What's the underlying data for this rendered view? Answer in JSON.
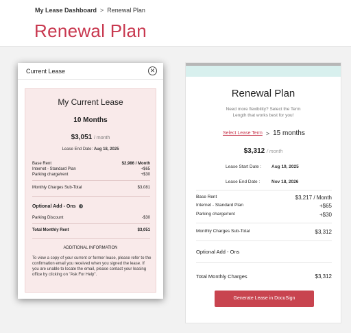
{
  "breadcrumb": {
    "home": "My Lease Dashboard",
    "separator": ">",
    "current": "Renewal Plan"
  },
  "page_title": "Renewal Plan",
  "current_lease_modal": {
    "title": "Current Lease",
    "close_icon": "close-icon",
    "heading": "My Current Lease",
    "months": "10 Months",
    "price": "$3,051",
    "per_month": "/ month",
    "end_date_label": "Lease End Date:",
    "end_date": "Aug 18, 2025",
    "base_rent_label": "Base Rent",
    "base_rent": "$2,986 / Month",
    "internet_label": "Internet - Standard Plan",
    "internet": "+$65",
    "parking_label": "Parking charge/rent",
    "parking": "+$30",
    "subtotal_label": "Monthly Charges Sub-Total",
    "subtotal": "$3,081",
    "optional_title": "Optional Add - Ons",
    "parking_discount_label": "Parking Discount",
    "parking_discount": "-$30",
    "total_label": "Total Monthly Rent",
    "total": "$3,051",
    "additional_info_title": "ADDITIONAL INFORMATION",
    "additional_info_text": "To view a copy of your current or former lease, please refer to the confirmation email you received when you signed the lease. If you are unable to locate the email, please contact your leasing office by clicking on \"Ask For Help\"."
  },
  "renewal_card": {
    "title": "Renewal Plan",
    "subtitle_line1": "Need more flexibility? Select the Term",
    "subtitle_line2": "Length that works best for you!",
    "select_term_link": "Select Lease Term",
    "term_arrow": ">",
    "term_value": "15 months",
    "price": "$3,312",
    "per_month": "/ month",
    "start_label": "Lease Start Date :",
    "start_date": "Aug 19, 2025",
    "end_label": "Lease End Date :",
    "end_date": "Nov 18, 2026",
    "base_rent_label": "Base Rent",
    "base_rent": "$3,217 / Month",
    "internet_label": "Internet - Standard Plan",
    "internet": "+$65",
    "parking_label": "Parking charge/rent",
    "parking": "+$30",
    "subtotal_label": "Monthly Charges Sub-Total",
    "subtotal": "$3,312",
    "optional_title": "Optional Add - Ons",
    "total_label": "Total Monthly Charges",
    "total": "$3,312",
    "cta_label": "Generate Lease in DocuSign"
  },
  "colors": {
    "accent": "#c8384f",
    "band": "#d8f0ee",
    "card_bg": "#f9eaea"
  }
}
